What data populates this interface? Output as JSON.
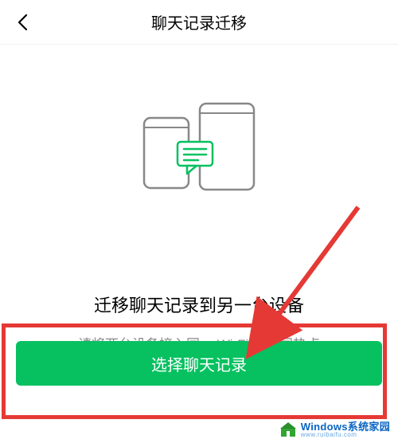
{
  "navbar": {
    "title": "聊天记录迁移"
  },
  "illustration": {
    "name": "phone-transfer-illustration"
  },
  "main": {
    "heading": "迁移聊天记录到另一台设备",
    "subtext": "请将两台设备接入同一 Wi-Fi 或相同热点",
    "cta_label": "选择聊天记录"
  },
  "annotation": {
    "highlight_color": "#e53935",
    "arrow_color": "#e53935"
  },
  "watermark": {
    "brand_top": "Windows系统家园",
    "brand_bottom": "www.ruibaifu.com"
  },
  "colors": {
    "primary": "#07c160",
    "text": "#000000",
    "muted": "#8a8a8a"
  }
}
